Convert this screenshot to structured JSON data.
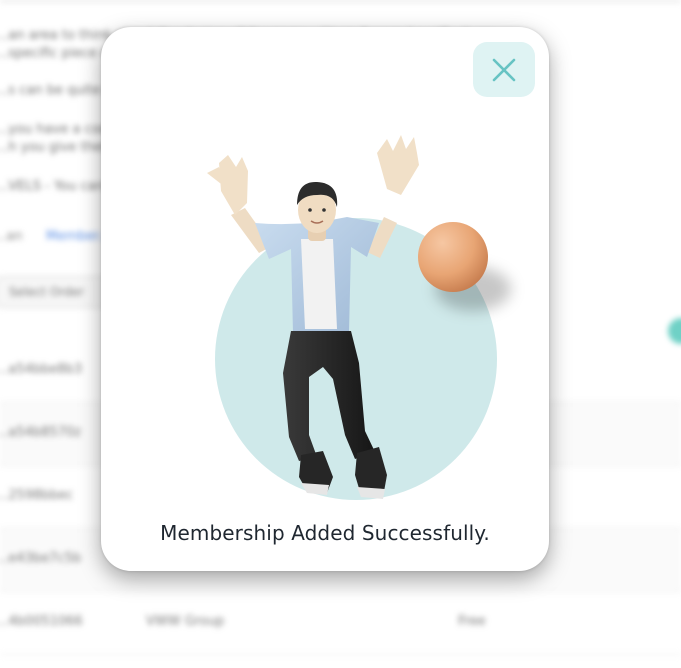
{
  "background": {
    "lines": [
      "...an area to think about the design of the page... Upon Access Level? where...",
      "...specific piece of...",
      "...s can be quite ge... ...outside the square of...",
      "...you have a coo... ...hen just create an acc...",
      "...h you give them...",
      "...VELS - You can... ...the edit window."
    ],
    "tabs": [
      "...an",
      "Member..."
    ],
    "select_label": "Select Order",
    "rows": [
      {
        "id": "...a54bbe8b3",
        "name": "",
        "status": ""
      },
      {
        "id": "...a54b8570z",
        "name": "",
        "status": ""
      },
      {
        "id": "...2598bbec",
        "name": "",
        "status": ""
      },
      {
        "id": "...e43be7c5b",
        "name": "",
        "status": ""
      },
      {
        "id": "...4b0051066",
        "name": "VWW Group",
        "status": "Free"
      }
    ]
  },
  "modal": {
    "message": "Membership Added Successfully.",
    "close_icon": "close-icon",
    "illustration": "celebrating-person-illustration",
    "colors": {
      "close_bg": "#dff3f3",
      "close_x": "#67c3c3",
      "circle": "#cfe9ea",
      "ball": "#e8a574"
    }
  }
}
